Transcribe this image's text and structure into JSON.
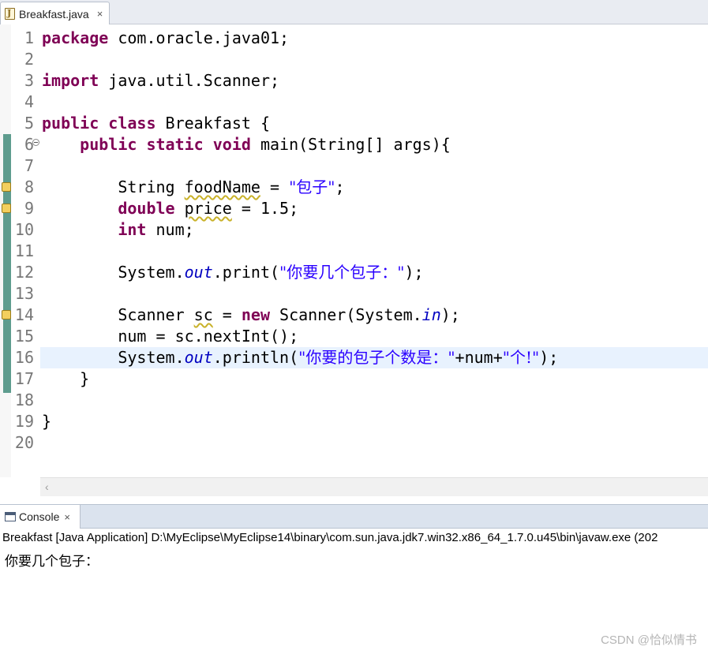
{
  "editor_tab": {
    "label": "Breakfast.java",
    "close": "×"
  },
  "line_numbers": [
    "1",
    "2",
    "3",
    "4",
    "5",
    "6",
    "7",
    "8",
    "9",
    "10",
    "11",
    "12",
    "13",
    "14",
    "15",
    "16",
    "17",
    "18",
    "19",
    "20"
  ],
  "code": {
    "l1_kw": "package",
    "l1_rest": " com.oracle.java01;",
    "l3_kw": "import",
    "l3_rest": " java.util.Scanner;",
    "l5_kw": "public class",
    "l5_rest": " Breakfast {",
    "l6_indent": "    ",
    "l6_kw": "public static void",
    "l6_rest": " main(String[] args){",
    "l8_a": "        String ",
    "l8_var": "foodName",
    "l8_b": " = ",
    "l8_str": "\"包子\"",
    "l8_end": ";",
    "l9_indent": "        ",
    "l9_kw": "double",
    "l9_a": " ",
    "l9_var": "price",
    "l9_b": " = 1.5;",
    "l10_indent": "        ",
    "l10_kw": "int",
    "l10_rest": " num;",
    "l12_a": "        System.",
    "l12_fld": "out",
    "l12_b": ".print(",
    "l12_str": "\"你要几个包子：\"",
    "l12_end": ");",
    "l14_a": "        Scanner ",
    "l14_var": "sc",
    "l14_b": " = ",
    "l14_kw": "new",
    "l14_c": " Scanner(System.",
    "l14_fld": "in",
    "l14_end": ");",
    "l15": "        num = sc.nextInt();",
    "l16_a": "        System.",
    "l16_fld": "out",
    "l16_b": ".println(",
    "l16_str1": "\"你要的包子个数是：\"",
    "l16_c": "+num+",
    "l16_str2": "\"个!\"",
    "l16_end": ");",
    "l17": "    }",
    "l19": "}"
  },
  "console": {
    "tab_label": "Console",
    "tab_close": "×",
    "launch_label": "Breakfast [Java Application] D:\\MyEclipse\\MyEclipse14\\binary\\com.sun.java.jdk7.win32.x86_64_1.7.0.u45\\bin\\javaw.exe (202",
    "output": "你要几个包子："
  },
  "watermark": "CSDN @恰似情书",
  "colors": {
    "keyword": "#7f0055",
    "string": "#2a00ff",
    "field": "#0000c0",
    "current_line": "#e8f2fe",
    "change_bar": "#5e9c8e"
  }
}
